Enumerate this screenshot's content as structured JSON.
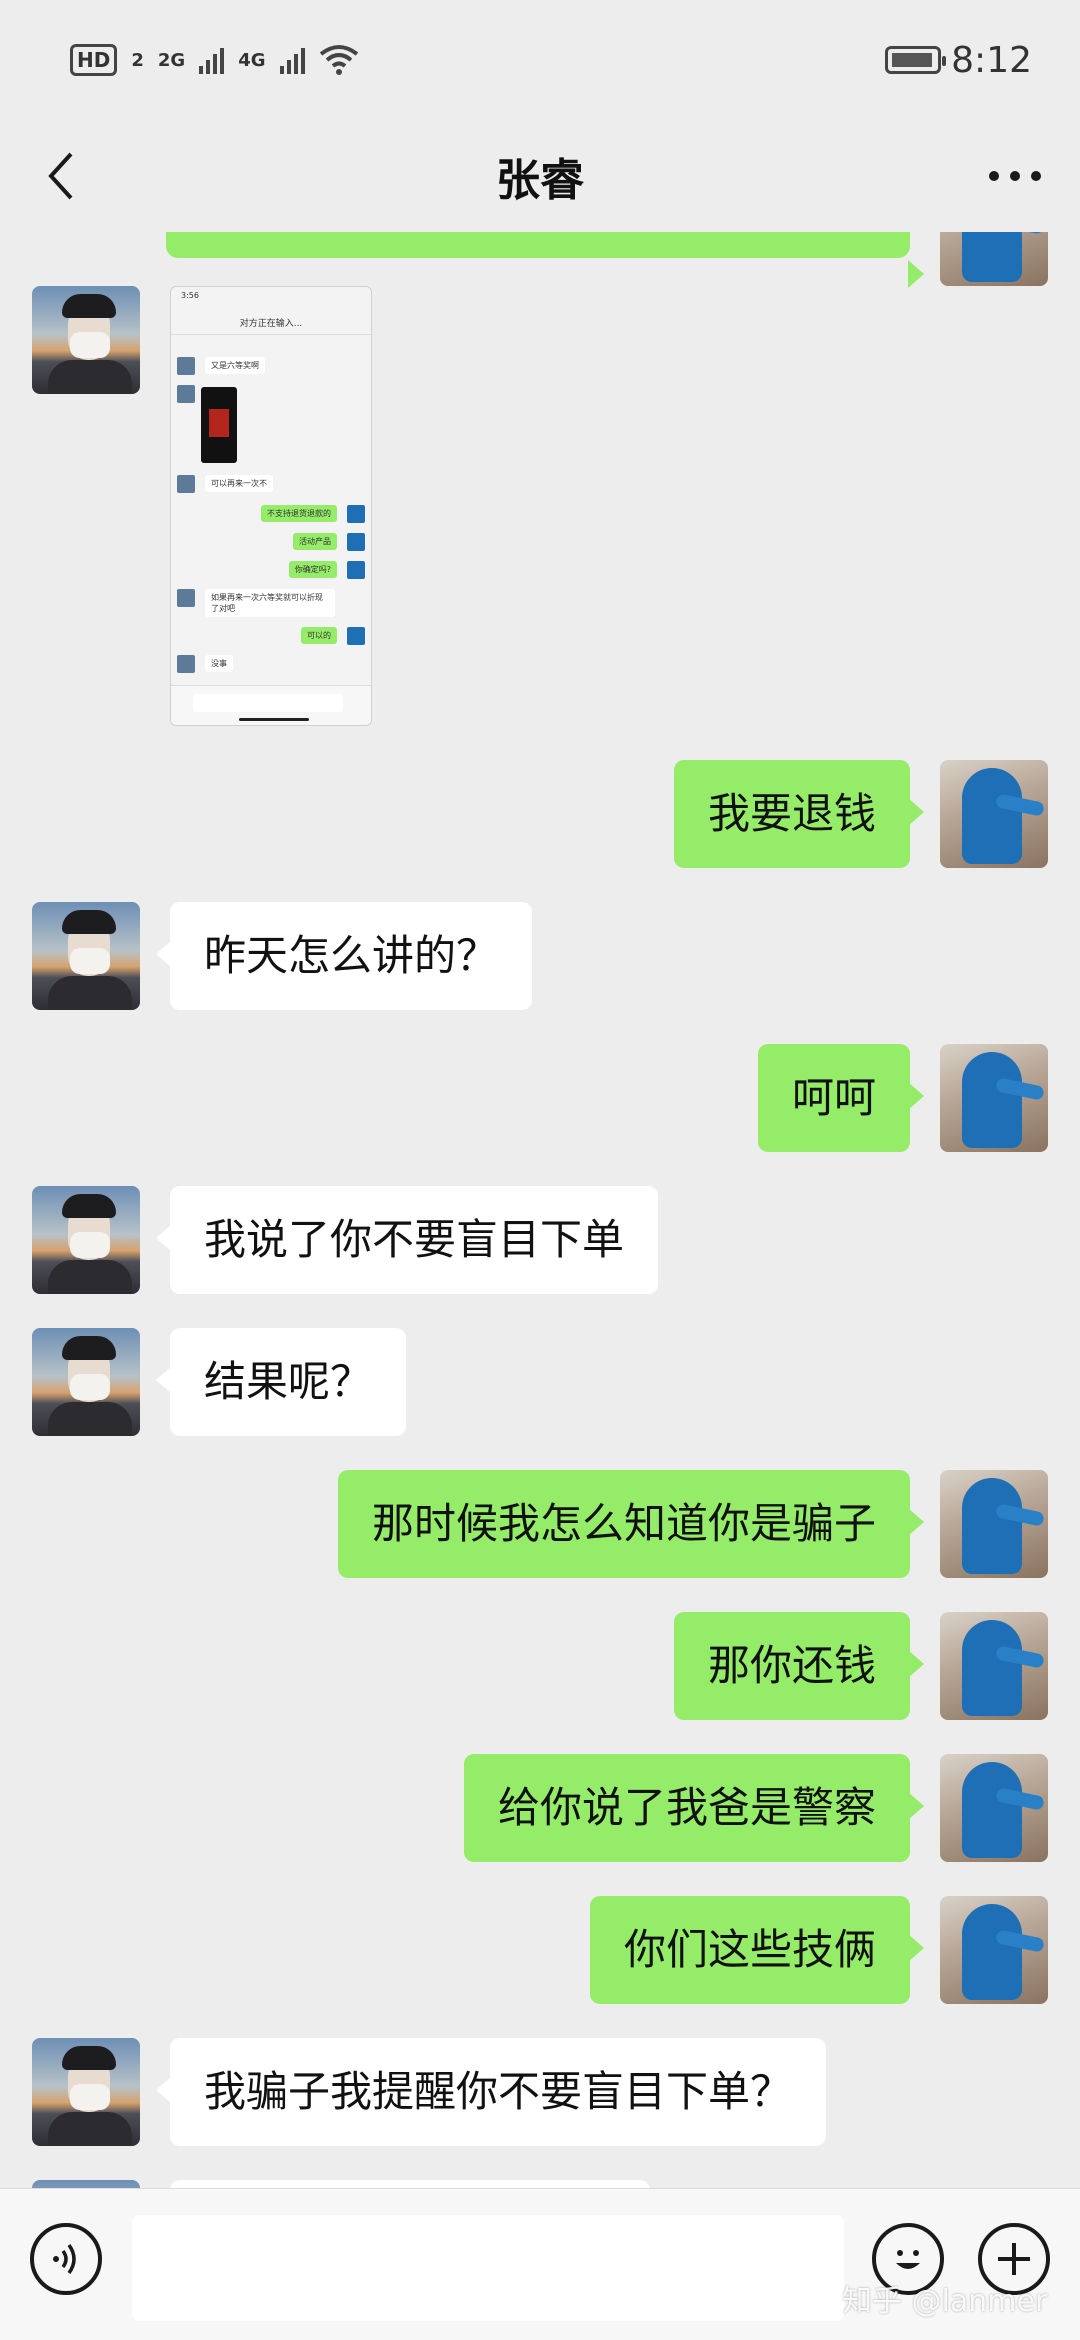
{
  "status_bar": {
    "hd_label": "HD",
    "hd_sub": "2",
    "net1": "2G",
    "net2": "4G",
    "time": "8:12"
  },
  "nav": {
    "title": "张睿",
    "back_icon": "chevron-left-icon",
    "more_icon": "more-horizontal-icon"
  },
  "screenshot_card": {
    "time": "3:56",
    "title": "对方正在输入...",
    "messages": [
      {
        "side": "o",
        "text": "又是六等奖啊"
      },
      {
        "side": "o",
        "text": "可以再来一次不"
      },
      {
        "side": "s",
        "text": "不支持退货退款的"
      },
      {
        "side": "s",
        "text": "活动产品"
      },
      {
        "side": "s",
        "text": "你确定吗?"
      },
      {
        "side": "o",
        "text": "如果再来一次六等奖就可以折现了对吧"
      },
      {
        "side": "s",
        "text": "可以的"
      },
      {
        "side": "o",
        "text": "没事"
      }
    ]
  },
  "messages": [
    {
      "side": "self",
      "text": "我要退钱"
    },
    {
      "side": "other",
      "text": "昨天怎么讲的？"
    },
    {
      "side": "self",
      "text": "呵呵"
    },
    {
      "side": "other",
      "text": "我说了你不要盲目下单"
    },
    {
      "side": "other",
      "text": "结果呢？"
    },
    {
      "side": "self",
      "text": "那时候我怎么知道你是骗子"
    },
    {
      "side": "self",
      "text": "那你还钱"
    },
    {
      "side": "self",
      "text": "给你说了我爸是警察"
    },
    {
      "side": "self",
      "text": "你们这些技俩"
    },
    {
      "side": "other",
      "text": "我骗子我提醒你不要盲目下单？"
    }
  ],
  "input_bar": {
    "voice_icon": "voice-icon",
    "emoji_icon": "emoji-icon",
    "plus_icon": "plus-icon"
  },
  "watermark": "知乎 @lanmer",
  "colors": {
    "background": "#ededed",
    "self_bubble": "#95ec69",
    "other_bubble": "#ffffff"
  }
}
